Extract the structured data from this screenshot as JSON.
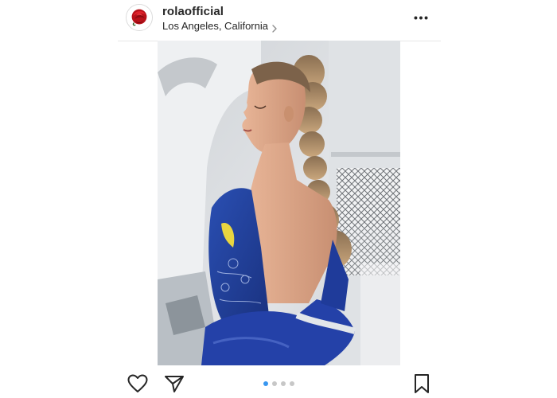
{
  "post": {
    "username": "rolaofficial",
    "location": "Los Angeles, California",
    "carousel": {
      "total": 4,
      "active_index": 0
    }
  },
  "icons": {
    "avatar": "rose-avatar",
    "location_chevron": "chevron-right-icon",
    "more": "more-options-icon",
    "like": "heart-icon",
    "share": "send-icon",
    "save": "bookmark-icon"
  },
  "colors": {
    "text": "#262626",
    "border": "#e6e6e6",
    "dot_active": "#3897f0",
    "dot_inactive": "#c7c7c7",
    "rose": "#c0141c"
  }
}
